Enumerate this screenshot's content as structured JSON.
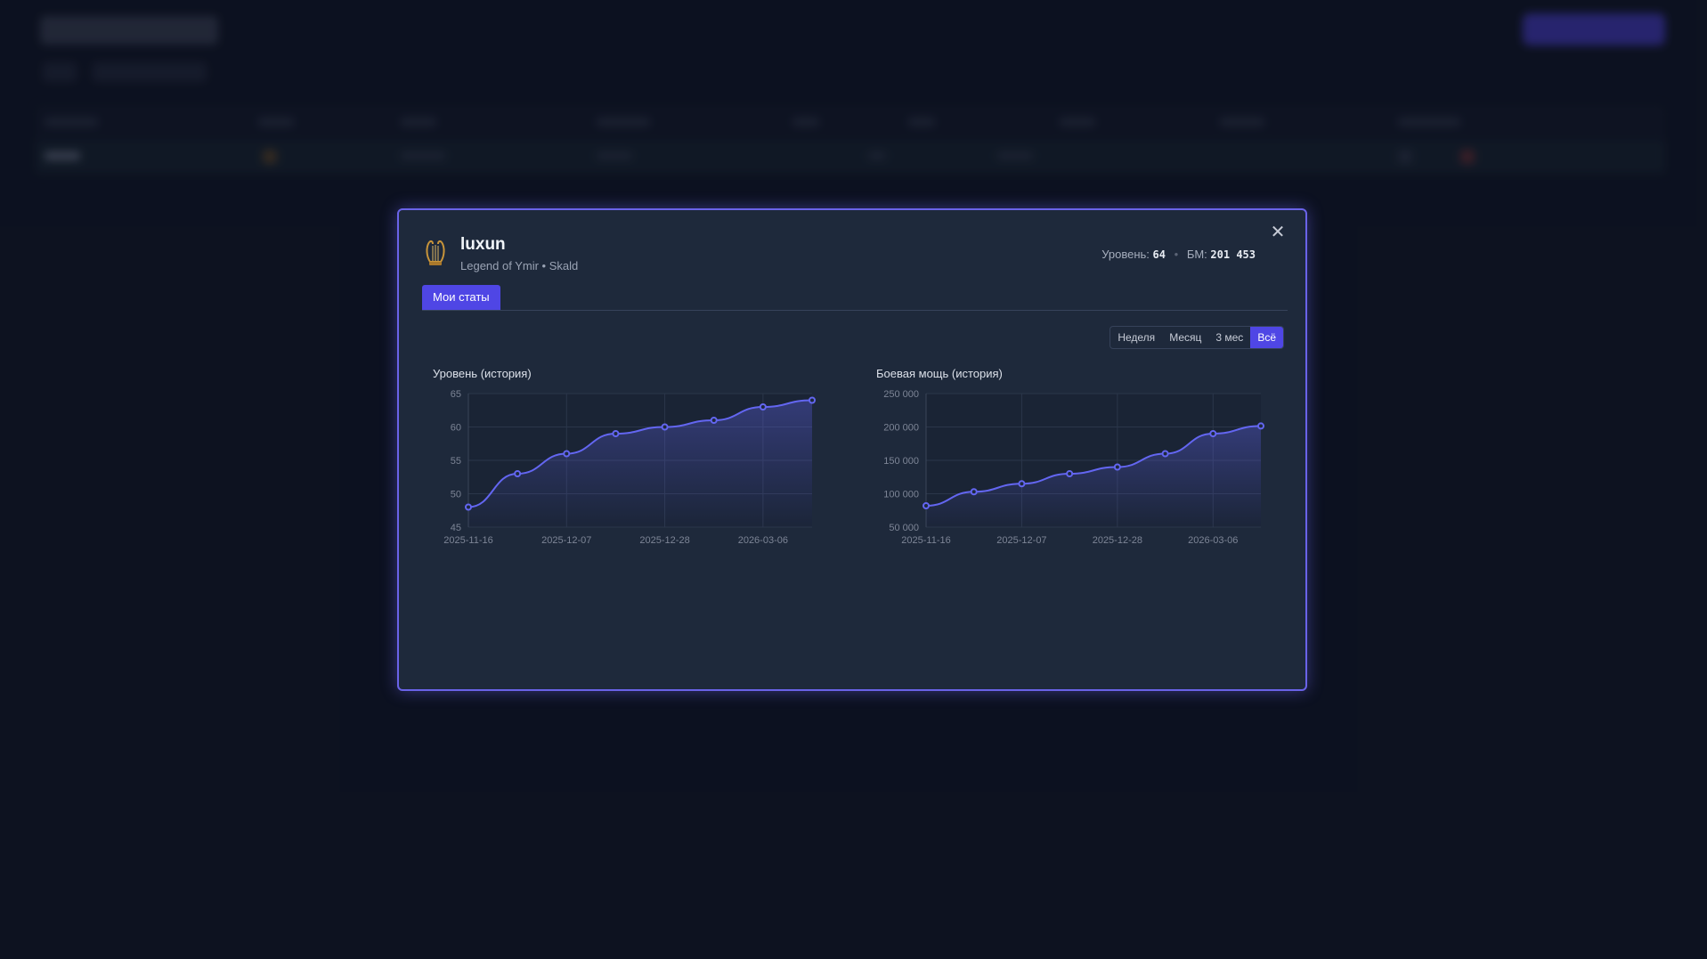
{
  "modal": {
    "close_label": "✕",
    "avatar_icon": "lyre-icon",
    "character": {
      "name": "luxun",
      "subtitle": "Legend of Ymir • Skald",
      "level_label": "Уровень:",
      "level_value": "64",
      "power_label": "БМ:",
      "power_value": "201 453"
    },
    "tabs": [
      {
        "label": "Мои статы",
        "active": true
      }
    ],
    "range_options": [
      {
        "label": "Неделя",
        "active": false
      },
      {
        "label": "Месяц",
        "active": false
      },
      {
        "label": "3 мес",
        "active": false
      },
      {
        "label": "Всё",
        "active": true
      }
    ],
    "accent_color": "#6366f1"
  },
  "chart_data": [
    {
      "type": "line",
      "title": "Уровень (история)",
      "x_ticks": [
        "2025-11-16",
        "2025-12-07",
        "2025-12-28",
        "2026-03-06"
      ],
      "y_ticks": [
        "65",
        "60",
        "55",
        "50",
        "45"
      ],
      "ylim": [
        45,
        65
      ],
      "values": [
        48,
        53,
        56,
        59,
        60,
        61,
        63,
        64
      ],
      "grid": true,
      "area_fill": true
    },
    {
      "type": "line",
      "title": "Боевая мощь (история)",
      "x_ticks": [
        "2025-11-16",
        "2025-12-07",
        "2025-12-28",
        "2026-03-06"
      ],
      "y_ticks": [
        "250 000",
        "200 000",
        "150 000",
        "100 000",
        "50 000"
      ],
      "ylim": [
        50000,
        250000
      ],
      "values": [
        82000,
        103000,
        115000,
        130000,
        140000,
        160000,
        190000,
        201453
      ],
      "grid": true,
      "area_fill": true
    }
  ]
}
